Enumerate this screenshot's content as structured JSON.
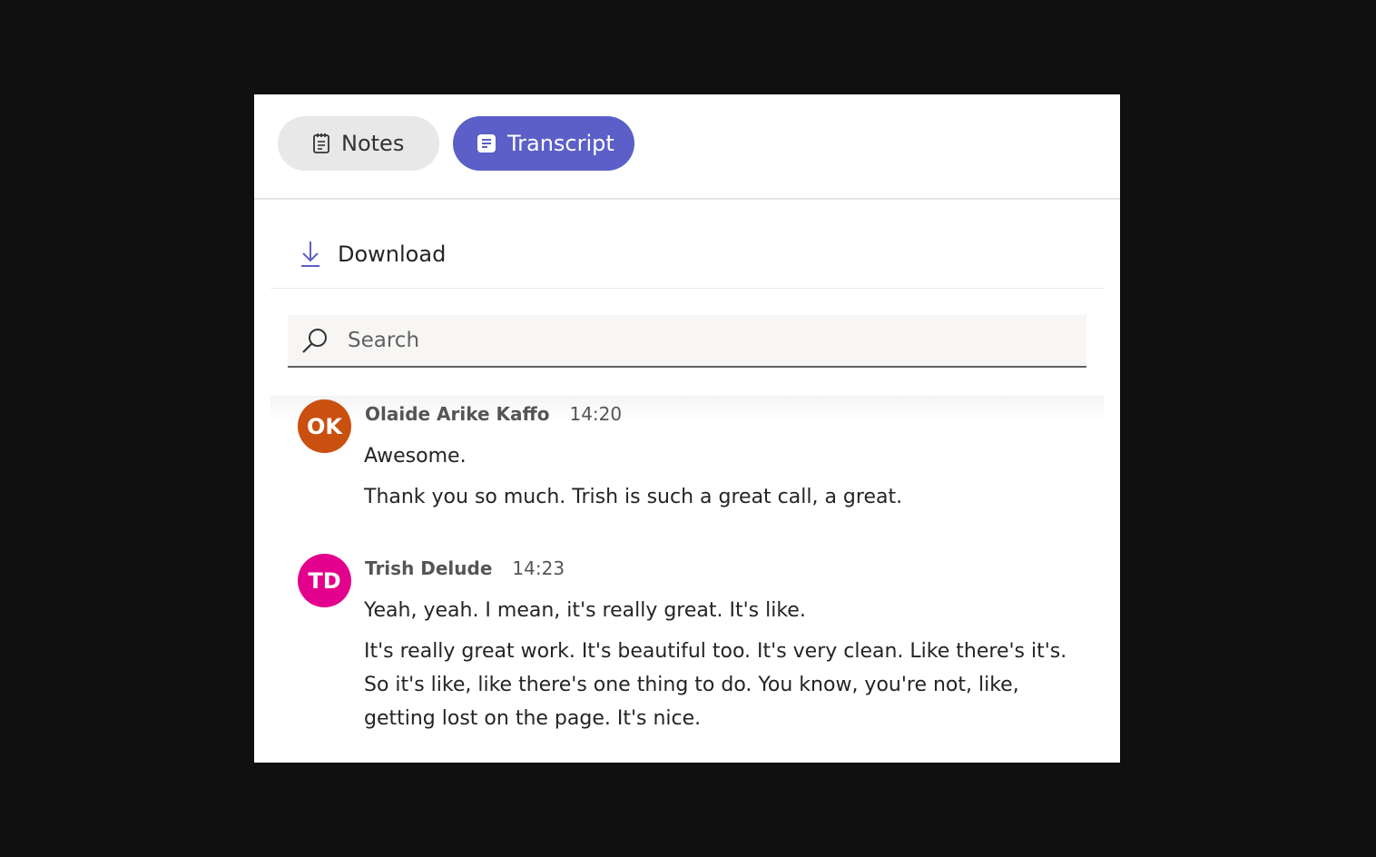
{
  "tabs": {
    "notes_label": "Notes",
    "transcript_label": "Transcript",
    "active": "Transcript"
  },
  "toolbar": {
    "download_label": "Download"
  },
  "search": {
    "placeholder": "Search",
    "value": ""
  },
  "colors": {
    "accent": "#5b5fc7",
    "avatar_ok": "#ca5010",
    "avatar_td": "#e3008c"
  },
  "transcript": [
    {
      "initials": "OK",
      "speaker": "Olaide Arike Kaffo",
      "time": "14:20",
      "lines": [
        "Awesome.",
        "Thank you so much. Trish is such a great call, a great."
      ]
    },
    {
      "initials": "TD",
      "speaker": "Trish Delude",
      "time": "14:23",
      "lines": [
        "Yeah, yeah. I mean, it's really great. It's like.",
        "It's really great work. It's beautiful too. It's very clean. Like there's it's. So it's like, like there's one thing to do. You know, you're not, like, getting lost on the page. It's nice."
      ]
    }
  ]
}
